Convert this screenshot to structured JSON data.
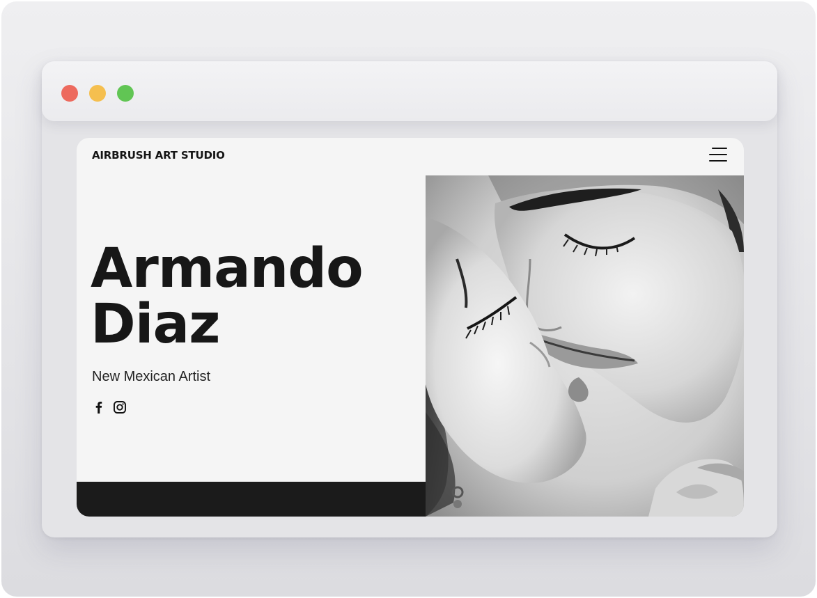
{
  "window": {
    "controls": [
      "close",
      "minimize",
      "maximize"
    ]
  },
  "site": {
    "brand": "AIRBRUSH ART STUDIO",
    "menu_icon": "hamburger-menu-icon",
    "hero": {
      "first_name": "Armando",
      "last_name": "Diaz",
      "tagline": "New Mexican Artist"
    },
    "social": [
      {
        "network": "facebook",
        "icon": "facebook-icon"
      },
      {
        "network": "instagram",
        "icon": "instagram-icon"
      }
    ],
    "artwork": {
      "style": "black-and-white airbrush portrait"
    },
    "colors": {
      "background": "#f5f5f5",
      "text": "#171717",
      "band": "#1b1b1b",
      "close": "#ed6a5e",
      "minimize": "#f5bf4f",
      "maximize": "#61c554"
    }
  }
}
